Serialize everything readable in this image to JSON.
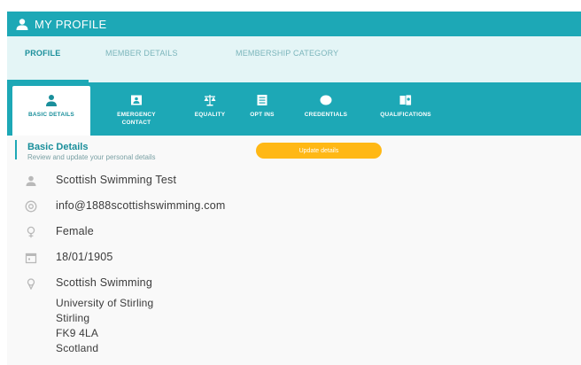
{
  "header": {
    "title": "MY PROFILE",
    "icon": "user-icon"
  },
  "tabs": [
    {
      "label": "PROFILE",
      "active": true
    },
    {
      "label": "MEMBER DETAILS",
      "active": false
    },
    {
      "label": "MEMBERSHIP CATEGORY",
      "active": false
    }
  ],
  "subnav": [
    {
      "label": "BASIC DETAILS",
      "icon": "person-icon",
      "active": true
    },
    {
      "label": "EMERGENCY CONTACT",
      "icon": "contact-card-icon",
      "active": false
    },
    {
      "label": "EQUALITY",
      "icon": "scales-icon",
      "active": false
    },
    {
      "label": "OPT INS",
      "icon": "list-icon",
      "active": false
    },
    {
      "label": "CREDENTIALS",
      "icon": "cloud-icon",
      "active": false
    },
    {
      "label": "QUALIFICATIONS",
      "icon": "certificate-icon",
      "active": false
    }
  ],
  "section": {
    "title": "Basic Details",
    "subtitle": "Review and update your personal details",
    "update_label": "Update details"
  },
  "details": {
    "name": "Scottish Swimming Test",
    "email": "info@1888scottishswimming.com",
    "gender": "Female",
    "dob": "18/01/1905",
    "club": "Scottish Swimming",
    "address": [
      "University of Stirling",
      "Stirling",
      "FK9 4LA",
      "Scotland"
    ]
  },
  "colors": {
    "primary": "#1da8b6",
    "tab_bg": "#e4f5f6",
    "button": "#ffb815"
  }
}
